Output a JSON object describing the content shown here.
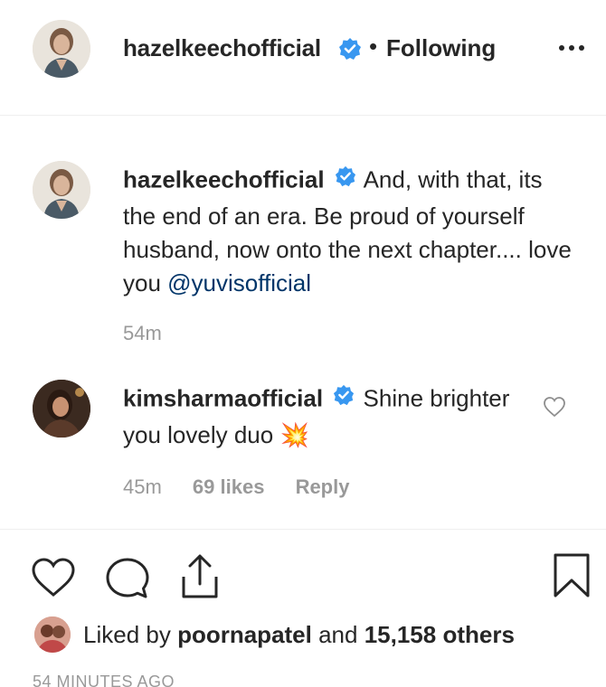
{
  "header": {
    "username": "hazelkeechofficial",
    "separator": "•",
    "follow_status": "Following"
  },
  "caption": {
    "username": "hazelkeechofficial",
    "text": " And, with that, its the end of an era. Be proud of yourself husband, now onto the next chapter.... love you ",
    "mention": "@yuvisofficial",
    "time": "54m"
  },
  "comment": {
    "username": "kimsharmaofficial",
    "text": " Shine brighter you lovely duo ",
    "emoji": "💥",
    "time": "45m",
    "likes": "69 likes",
    "reply": "Reply"
  },
  "likes": {
    "prefix": "Liked by ",
    "user": "poornapatel",
    "middle": " and ",
    "count": "15,158 others"
  },
  "timestamp": "54 MINUTES AGO",
  "colors": {
    "verified": "#3897f0",
    "mention": "#003569",
    "muted": "#999999",
    "text": "#262626"
  },
  "icons": [
    "verified-badge-icon",
    "more-options-icon",
    "heart-icon",
    "comment-icon",
    "share-icon",
    "bookmark-icon"
  ]
}
